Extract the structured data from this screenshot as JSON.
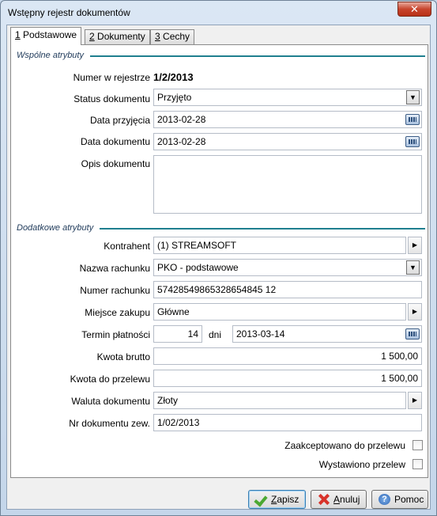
{
  "window": {
    "title": "Wstępny rejestr dokumentów",
    "close_symbol": "✕"
  },
  "tabs": [
    {
      "mnemonic": "1",
      "label": " Podstawowe"
    },
    {
      "mnemonic": "2",
      "label": " Dokumenty"
    },
    {
      "mnemonic": "3",
      "label": " Cechy"
    }
  ],
  "sections": {
    "common": "Wspólne atrybuty",
    "additional": "Dodatkowe atrybuty"
  },
  "fields": {
    "register_number": {
      "label": "Numer w rejestrze",
      "value": "1/2/2013"
    },
    "status": {
      "label": "Status dokumentu",
      "value": "Przyjęto"
    },
    "received_date": {
      "label": "Data przyjęcia",
      "value": "2013-02-28"
    },
    "document_date": {
      "label": "Data dokumentu",
      "value": "2013-02-28"
    },
    "description": {
      "label": "Opis dokumentu",
      "value": ""
    },
    "contractor": {
      "label": "Kontrahent",
      "value": "(1) STREAMSOFT"
    },
    "account_name": {
      "label": "Nazwa rachunku",
      "value": "PKO - podstawowe"
    },
    "account_number": {
      "label": "Numer rachunku",
      "value": "57428549865328654845 12"
    },
    "purchase_place": {
      "label": "Miejsce zakupu",
      "value": "Główne"
    },
    "payment_term": {
      "label": "Termin płatności",
      "days": "14",
      "days_unit": "dni",
      "date": "2013-03-14"
    },
    "gross_amount": {
      "label": "Kwota brutto",
      "value": "1 500,00"
    },
    "transfer_amount": {
      "label": "Kwota do przelewu",
      "value": "1 500,00"
    },
    "currency": {
      "label": "Waluta dokumentu",
      "value": "Złoty"
    },
    "external_number": {
      "label": "Nr dokumentu zew.",
      "value": "1/02/2013"
    }
  },
  "checkboxes": {
    "accepted_for_transfer": {
      "label": "Zaakceptowano do przelewu",
      "checked": false
    },
    "transfer_issued": {
      "label": "Wystawiono przelew",
      "checked": false
    }
  },
  "buttons": {
    "save": {
      "mnemonic": "Z",
      "rest": "apisz"
    },
    "cancel": {
      "mnemonic": "A",
      "rest": "nuluj"
    },
    "help": {
      "label": "Pomoc"
    }
  },
  "icons": {
    "dropdown": "▼",
    "arrow_right": "▶",
    "help": "?"
  }
}
